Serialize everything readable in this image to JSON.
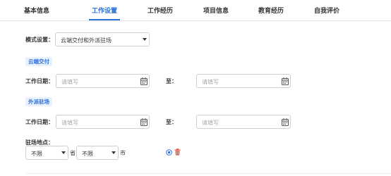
{
  "tabs": [
    {
      "label": "基本信息",
      "active": false
    },
    {
      "label": "工作设置",
      "active": true
    },
    {
      "label": "工作经历",
      "active": false
    },
    {
      "label": "项目信息",
      "active": false
    },
    {
      "label": "教育经历",
      "active": false
    },
    {
      "label": "自我评价",
      "active": false
    }
  ],
  "mode": {
    "label": "模式设置：",
    "value": "云端交付和外派驻场"
  },
  "cloud": {
    "tag": "云端交付",
    "work_date_label": "工作日期：",
    "start_placeholder": "请填写",
    "to_label": "至：",
    "end_placeholder": "请填写"
  },
  "onsite": {
    "tag": "外派驻场",
    "work_date_label": "工作日期：",
    "start_placeholder": "请填写",
    "to_label": "至：",
    "end_placeholder": "请填写",
    "location_label": "驻场地点：",
    "province_value": "不限",
    "province_suffix": "省",
    "city_value": "不限",
    "city_suffix": "市"
  },
  "icons": {
    "calendar": "calendar-icon",
    "add": "add-circle-icon",
    "delete": "trash-icon",
    "caret": "chevron-down-icon"
  },
  "colors": {
    "accent": "#2c6fd6",
    "tag_bg": "#e9f1fc",
    "delete": "#e0533a",
    "placeholder": "#aaaaaa"
  }
}
